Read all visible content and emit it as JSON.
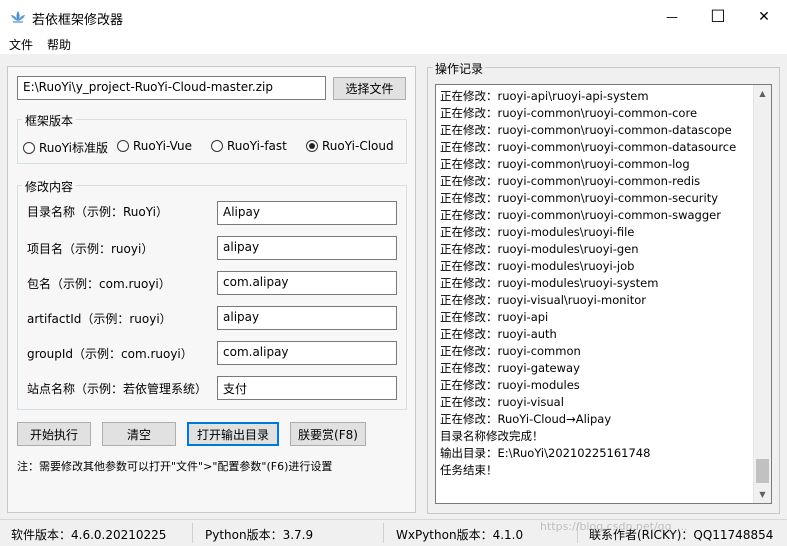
{
  "window": {
    "title": "若依框架修改器",
    "icon": "ruoyi-lotus-icon",
    "minimize_glyph": "—",
    "maximize_glyph": "☐",
    "close_glyph": "✕"
  },
  "menu": {
    "file": "文件",
    "help": "帮助"
  },
  "form": {
    "path_value": "E:\\RuoYi\\y_project-RuoYi-Cloud-master.zip",
    "choose_file_button": "选择文件",
    "framework_group_label": "框架版本",
    "frameworks": [
      {
        "label": "RuoYi标准版",
        "checked": false
      },
      {
        "label": "RuoYi-Vue",
        "checked": false
      },
      {
        "label": "RuoYi-fast",
        "checked": false
      },
      {
        "label": "RuoYi-Cloud",
        "checked": true
      }
    ],
    "modify_group_label": "修改内容",
    "fields": [
      {
        "label": "目录名称（示例：RuoYi）",
        "value": "Alipay"
      },
      {
        "label": "项目名（示例：ruoyi）",
        "value": "alipay"
      },
      {
        "label": "包名（示例：com.ruoyi）",
        "value": "com.alipay"
      },
      {
        "label": "artifactId（示例：ruoyi）",
        "value": "alipay"
      },
      {
        "label": "groupId（示例：com.ruoyi）",
        "value": "com.alipay"
      },
      {
        "label": "站点名称（示例：若依管理系统）",
        "value": "支付"
      }
    ],
    "buttons": {
      "start": "开始执行",
      "clear": "清空",
      "open_output": "打开输出目录",
      "reward": "朕要赏(F8)"
    },
    "note": "注：需要修改其他参数可以打开\"文件\">\"配置参数\"(F6)进行设置"
  },
  "log": {
    "group_label": "操作记录",
    "lines": [
      "正在修改：ruoyi-api\\ruoyi-api-system",
      "正在修改：ruoyi-common\\ruoyi-common-core",
      "正在修改：ruoyi-common\\ruoyi-common-datascope",
      "正在修改：ruoyi-common\\ruoyi-common-datasource",
      "正在修改：ruoyi-common\\ruoyi-common-log",
      "正在修改：ruoyi-common\\ruoyi-common-redis",
      "正在修改：ruoyi-common\\ruoyi-common-security",
      "正在修改：ruoyi-common\\ruoyi-common-swagger",
      "正在修改：ruoyi-modules\\ruoyi-file",
      "正在修改：ruoyi-modules\\ruoyi-gen",
      "正在修改：ruoyi-modules\\ruoyi-job",
      "正在修改：ruoyi-modules\\ruoyi-system",
      "正在修改：ruoyi-visual\\ruoyi-monitor",
      "正在修改：ruoyi-api",
      "正在修改：ruoyi-auth",
      "正在修改：ruoyi-common",
      "正在修改：ruoyi-gateway",
      "正在修改：ruoyi-modules",
      "正在修改：ruoyi-visual",
      "正在修改：RuoYi-Cloud→Alipay",
      "目录名称修改完成！",
      "输出目录：E:\\RuoYi\\20210225161748",
      "任务结束！"
    ]
  },
  "status": {
    "software_version": "软件版本：4.6.0.20210225",
    "python_version": "Python版本：3.7.9",
    "wxpython_version": "WxPython版本：4.1.0",
    "contact": "联系作者(RICKY)：QQ11748854"
  },
  "watermark": "https://blog.csdn.net/qq_...",
  "colors": {
    "accent": "#0078d7",
    "window_bg": "#f0f0f0"
  }
}
